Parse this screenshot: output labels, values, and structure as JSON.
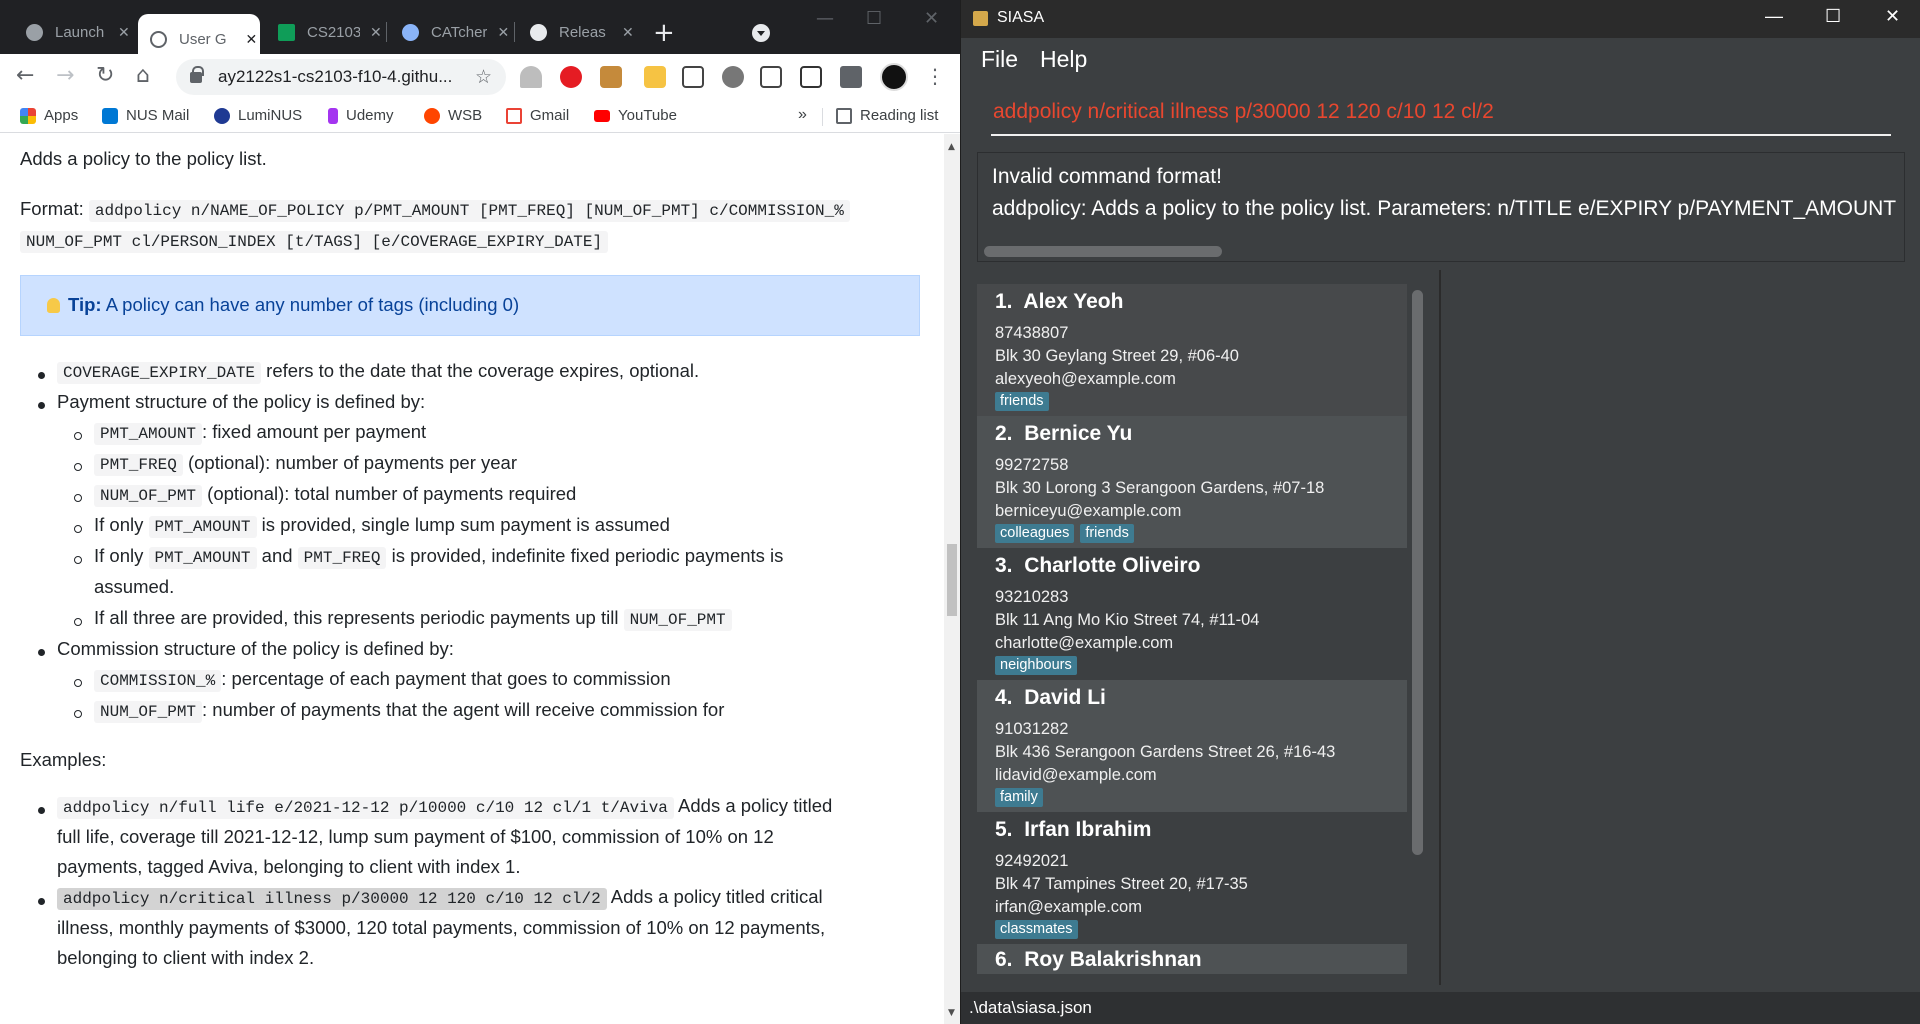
{
  "browser": {
    "tabs": [
      {
        "title": "Launch",
        "favicon_color": "#9aa0a6"
      },
      {
        "title": "User G",
        "favicon_color": "#202124",
        "active": true
      },
      {
        "title": "CS2103",
        "favicon_color": "#0f9d58"
      },
      {
        "title": "CATcher",
        "favicon_color": "#8ab4f8"
      },
      {
        "title": "Releas",
        "favicon_color": "#e8eaed"
      }
    ],
    "new_tab_label": "+",
    "url": "ay2122s1-cs2103-f10-4.githu...",
    "bookmarks": [
      {
        "label": "Apps",
        "icon": "apps-grid-icon",
        "color": "#ea4335"
      },
      {
        "label": "NUS Mail",
        "icon": "outlook-icon",
        "color": "#0078d4"
      },
      {
        "label": "LumiNUS",
        "icon": "luminus-icon",
        "color": "#1f3a93"
      },
      {
        "label": "Udemy",
        "icon": "udemy-icon",
        "color": "#a435f0"
      },
      {
        "label": "WSB",
        "icon": "reddit-icon",
        "color": "#ff4500"
      },
      {
        "label": "Gmail",
        "icon": "gmail-icon",
        "color": "#ea4335"
      },
      {
        "label": "YouTube",
        "icon": "youtube-icon",
        "color": "#ff0000"
      }
    ],
    "more_label": "»",
    "reading_list": "Reading list"
  },
  "doc": {
    "intro": "Adds a policy to the policy list.",
    "format_label": "Format:",
    "format_code_1": "addpolicy n/NAME_OF_POLICY p/PMT_AMOUNT [PMT_FREQ] [NUM_OF_PMT] c/COMMISSION_%",
    "format_code_2": "NUM_OF_PMT cl/PERSON_INDEX [t/TAGS] [e/COVERAGE_EXPIRY_DATE]",
    "tip_label": "Tip:",
    "tip_text": " A policy can have any number of tags (including 0)",
    "b1_code": "COVERAGE_EXPIRY_DATE",
    "b1_text": " refers to the date that the coverage expires, optional.",
    "b2_text": "Payment structure of the policy is defined by:",
    "s1_code": "PMT_AMOUNT",
    "s1_text": ": fixed amount per payment",
    "s2_code": "PMT_FREQ",
    "s2_text": " (optional): number of payments per year",
    "s3_code": "NUM_OF_PMT",
    "s3_text": " (optional): total number of payments required",
    "s4_pre": "If only ",
    "s4_code": "PMT_AMOUNT",
    "s4_text": " is provided, single lump sum payment is assumed",
    "s5_pre": "If only ",
    "s5_code_a": "PMT_AMOUNT",
    "s5_mid": " and ",
    "s5_code_b": "PMT_FREQ",
    "s5_text": " is provided, indefinite fixed periodic payments is",
    "s5_text2": "assumed.",
    "s6_text": "If all three are provided, this represents periodic payments up till ",
    "s6_code": "NUM_OF_PMT",
    "b3_text": "Commission structure of the policy is defined by:",
    "c1_code": "COMMISSION_%",
    "c1_text": ": percentage of each payment that goes to commission",
    "c2_code": "NUM_OF_PMT",
    "c2_text": ": number of payments that the agent will receive commission for",
    "examples_label": "Examples:",
    "e1_code": "addpolicy n/full life e/2021-12-12 p/10000 c/10 12 cl/1 t/Aviva",
    "e1_text": " Adds a policy titled",
    "e1_text2": "full life, coverage till 2021-12-12, lump sum payment of $100, commission of 10% on 12",
    "e1_text3": "payments, tagged Aviva, belonging to client with index 1.",
    "e2_code": "addpolicy n/critical illness p/30000 12 120 c/10 12 cl/2",
    "e2_text": " Adds a policy titled critical",
    "e2_text2": "illness, monthly payments of $3000, 120 total payments, commission of 10% on 12 payments,",
    "e2_text3": "belonging to client with index 2."
  },
  "siasa": {
    "window_title": "SIASA",
    "menu": {
      "file": "File",
      "help": "Help"
    },
    "command_input": "addpolicy n/critical illness p/30000 12 120 c/10 12 cl/2",
    "result_line1": "Invalid command format!",
    "result_line2": "addpolicy: Adds a policy to the policy list. Parameters: n/TITLE e/EXPIRY p/PAYMENT_AMOUNT [",
    "persons": [
      {
        "index": "1.",
        "name": "Alex Yeoh",
        "phone": "87438807",
        "address": "Blk 30 Geylang Street 29, #06-40",
        "email": "alexyeoh@example.com",
        "tags": [
          "friends"
        ]
      },
      {
        "index": "2.",
        "name": "Bernice Yu",
        "phone": "99272758",
        "address": "Blk 30 Lorong 3 Serangoon Gardens, #07-18",
        "email": "berniceyu@example.com",
        "tags": [
          "colleagues",
          "friends"
        ]
      },
      {
        "index": "3.",
        "name": "Charlotte Oliveiro",
        "phone": "93210283",
        "address": "Blk 11 Ang Mo Kio Street 74, #11-04",
        "email": "charlotte@example.com",
        "tags": [
          "neighbours"
        ]
      },
      {
        "index": "4.",
        "name": "David Li",
        "phone": "91031282",
        "address": "Blk 436 Serangoon Gardens Street 26, #16-43",
        "email": "lidavid@example.com",
        "tags": [
          "family"
        ]
      },
      {
        "index": "5.",
        "name": "Irfan Ibrahim",
        "phone": "92492021",
        "address": "Blk 47 Tampines Street 20, #17-35",
        "email": "irfan@example.com",
        "tags": [
          "classmates"
        ]
      },
      {
        "index": "6.",
        "name": "Roy Balakrishnan",
        "phone": "",
        "address": "",
        "email": "",
        "tags": []
      }
    ],
    "status_path": ".\\data\\siasa.json"
  }
}
